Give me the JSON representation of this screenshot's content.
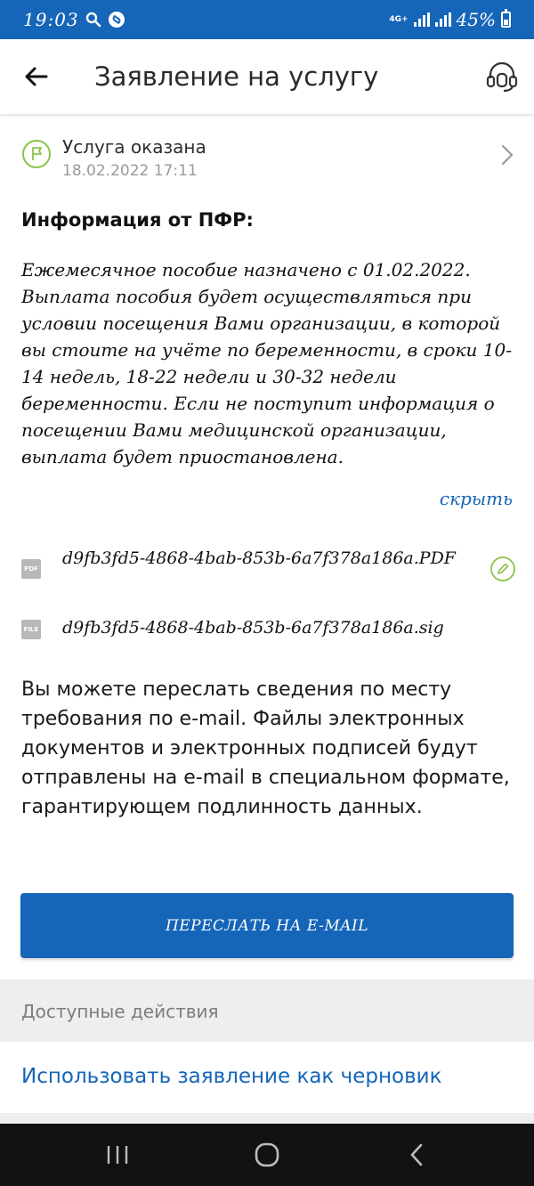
{
  "status_bar": {
    "time": "19:03",
    "network": "4G+",
    "battery": "45%"
  },
  "header": {
    "title": "Заявление на услугу"
  },
  "status": {
    "title": "Услуга оказана",
    "date": "18.02.2022 17:11"
  },
  "info": {
    "heading": "Информация от ПФР:",
    "text": "Ежемесячное пособие назначено с 01.02.2022. Выплата пособия будет осуществляться при условии посещения Вами организации, в которой вы стоите на учёте по беременности, в сроки 10-14 недель, 18-22 недели и 30-32 недели беременности. Если не поступит информация о посещении Вами медицинской организации, выплата будет приостановлена.",
    "hide_label": "скрыть"
  },
  "files": [
    {
      "badge": "PDF",
      "name": "d9fb3fd5-4868-4bab-853b-6a7f378a186a.PDF"
    },
    {
      "badge": "FILE",
      "name": "d9fb3fd5-4868-4bab-853b-6a7f378a186a.sig"
    }
  ],
  "forward": {
    "text": "Вы можете переслать сведения по месту требования по e-mail. Файлы электронных документов и электронных подписей будут отправлены на e-mail в специальном формате, гарантирующем подлинность данных.",
    "button_label": "ПЕРЕСЛАТЬ НА E-MAIL"
  },
  "actions": {
    "section_label": "Доступные действия",
    "draft_link": "Использовать заявление как черновик"
  },
  "colors": {
    "primary": "#1565b8",
    "accent_green": "#8bc34a",
    "muted_text": "#9a9a9a"
  },
  "icons": {
    "back": "arrow-left-icon",
    "support": "headset-icon",
    "status": "flag-icon",
    "chevron": "chevron-right-icon",
    "sign": "pen-icon"
  }
}
